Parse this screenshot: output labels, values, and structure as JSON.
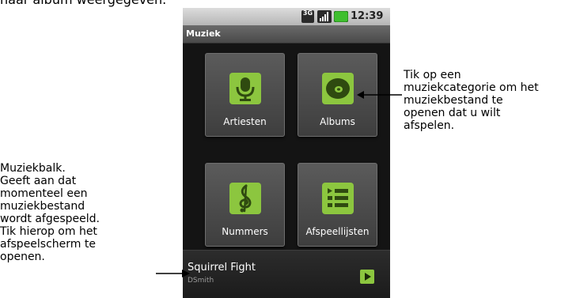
{
  "top_caption": "naar album weergegeven.",
  "status_bar": {
    "network_type": "3G",
    "time": "12:39"
  },
  "app_title": "Muziek",
  "tiles": [
    {
      "label": "Artiesten",
      "icon": "microphone-icon"
    },
    {
      "label": "Albums",
      "icon": "disc-icon"
    },
    {
      "label": "Nummers",
      "icon": "treble-clef-icon"
    },
    {
      "label": "Afspeellijsten",
      "icon": "playlist-icon"
    }
  ],
  "now_playing": {
    "title": "Squirrel Fight",
    "artist": "DSmith"
  },
  "callouts": {
    "right": [
      "Tik op een",
      "muziekcategorie om het",
      "muziekbestand te",
      "openen dat u wilt",
      "afspelen."
    ],
    "left": [
      "Muziekbalk.",
      "Geeft aan dat",
      "momenteel een",
      "muziekbestand",
      "wordt afgespeeld.",
      "Tik hierop om het",
      "afspeelscherm te",
      "openen."
    ]
  },
  "colors": {
    "accent_green": "#8cc63f",
    "icon_dark_green": "#2f4a10",
    "tile_background": "#4a4a4a"
  }
}
